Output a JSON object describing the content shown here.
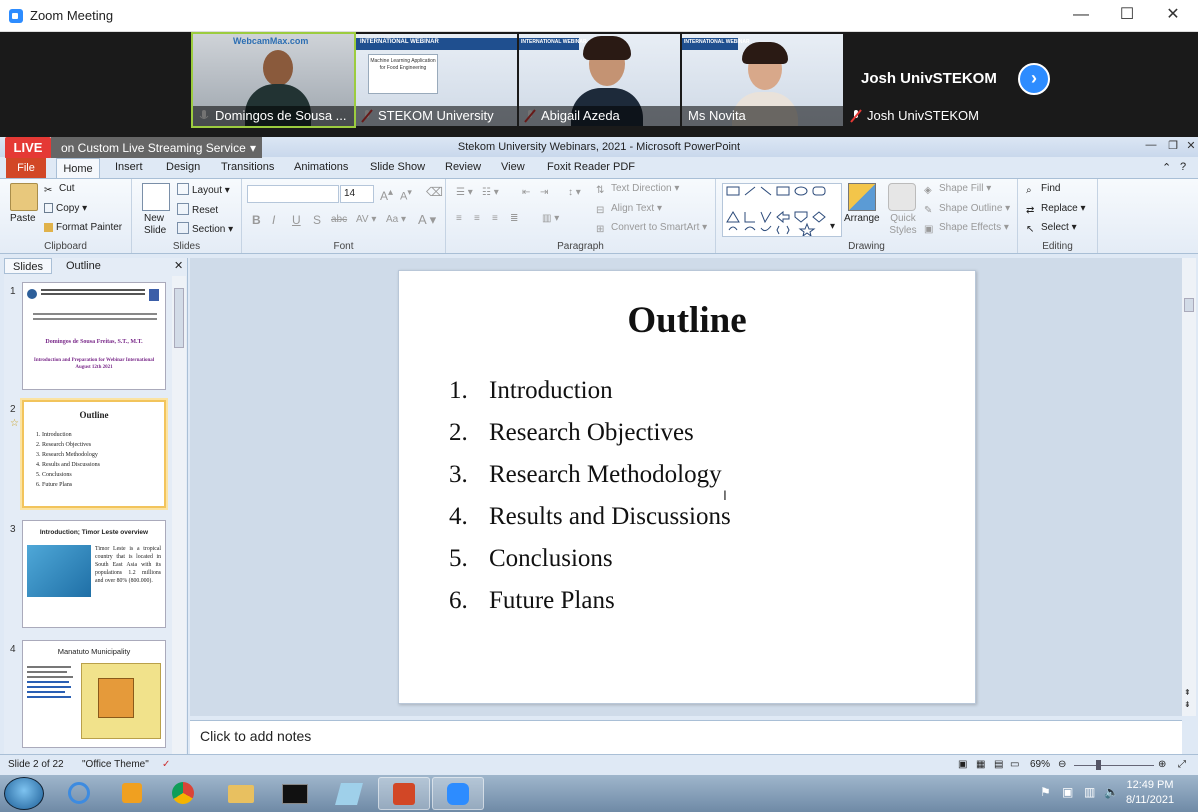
{
  "zoom": {
    "title": "Zoom Meeting",
    "minimize": "—",
    "maximize": "☐",
    "close": "✕",
    "participants": [
      {
        "name": "Domingos de Sousa ...",
        "watermark": "WebcamMax.com"
      },
      {
        "name": "STEKOM University",
        "banner": "INTERNATIONAL WEBINAR",
        "slide_text": "Machine Learning Application for Food Engineering"
      },
      {
        "name": "Abigail Azeda",
        "banner": "INTERNATIONAL WEBINAR"
      },
      {
        "name": "Ms Novita",
        "banner": "INTERNATIONAL WEBINAR"
      },
      {
        "name": "Josh UnivSTEKOM"
      }
    ],
    "big_name": "Josh UnivSTEKOM",
    "next_arrow": "›"
  },
  "live": {
    "badge": "LIVE",
    "service": "on Custom Live Streaming Service",
    "caret": "▾"
  },
  "ppt": {
    "title": "Stekom University Webinars, 2021  -  Microsoft PowerPoint",
    "tabs": [
      "File",
      "Home",
      "Insert",
      "Design",
      "Transitions",
      "Animations",
      "Slide Show",
      "Review",
      "View",
      "Foxit Reader PDF"
    ],
    "clipboard": {
      "paste": "Paste",
      "cut": "Cut",
      "copy": "Copy",
      "format_painter": "Format Painter",
      "label": "Clipboard"
    },
    "slides_group": {
      "new_slide": "New Slide",
      "layout": "Layout",
      "reset": "Reset",
      "section": "Section",
      "label": "Slides"
    },
    "font": {
      "size": "14",
      "label": "Font",
      "bold": "B",
      "italic": "I",
      "underline": "U",
      "strike": "S",
      "spacing": "abc",
      "case": "Aa",
      "color": "A"
    },
    "paragraph": {
      "text_direction": "Text Direction",
      "align_text": "Align Text",
      "smartart": "Convert to SmartArt",
      "label": "Paragraph"
    },
    "drawing": {
      "arrange": "Arrange",
      "quick_styles": "Quick Styles",
      "shape_fill": "Shape Fill",
      "shape_outline": "Shape Outline",
      "shape_effects": "Shape Effects",
      "label": "Drawing"
    },
    "editing": {
      "find": "Find",
      "replace": "Replace",
      "select": "Select",
      "label": "Editing"
    },
    "panel_tabs": {
      "slides": "Slides",
      "outline": "Outline"
    },
    "thumbs": [
      {
        "num": "1",
        "title": "Domingos de Sousa Freitas, S.T., M.T.",
        "subtitle": "Introduction and Preparation for Webinar International August 12th 2021"
      },
      {
        "num": "2",
        "title": "Outline",
        "items": [
          "1.   Introduction",
          "2.   Research Objectives",
          "3.   Research Methodology",
          "4.   Results and Discussions",
          "5.   Conclusions",
          "6.   Future Plans"
        ]
      },
      {
        "num": "3",
        "title": "Introduction; Timor Leste overview",
        "body": "Timor Leste is a tropical country that is located in South East Asia with its populations 1.2 millions and over 80% (800.000)."
      },
      {
        "num": "4",
        "title": "Manatuto Municipality"
      }
    ],
    "slide": {
      "title": "Outline",
      "items": [
        {
          "n": "1.",
          "text": "Introduction"
        },
        {
          "n": "2.",
          "text": "Research Objectives"
        },
        {
          "n": "3.",
          "text": "Research Methodology"
        },
        {
          "n": "4.",
          "text": "Results and Discussions"
        },
        {
          "n": "5.",
          "text": "Conclusions"
        },
        {
          "n": "6.",
          "text": "Future Plans"
        }
      ]
    },
    "notes_placeholder": "Click to add notes",
    "status": {
      "slide": "Slide 2 of 22",
      "theme": "\"Office Theme\"",
      "zoom": "69%"
    }
  },
  "taskbar": {
    "time": "12:49 PM",
    "date": "8/11/2021"
  },
  "colors": {
    "zoom_blue": "#2d8cff",
    "live_red": "#e53935",
    "file_tab": "#d24726",
    "active_speaker": "#9ccc3f"
  }
}
